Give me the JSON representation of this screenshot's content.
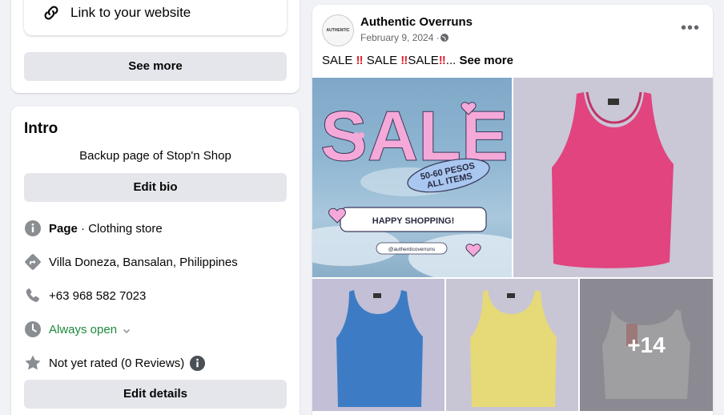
{
  "left": {
    "link_text": "Link to your website",
    "see_more": "See more"
  },
  "intro": {
    "title": "Intro",
    "bio": "Backup page of Stop'n Shop",
    "edit_bio": "Edit bio",
    "page_label": "Page",
    "page_category": " · Clothing store",
    "location": "Villa Doneza, Bansalan, Philippines",
    "phone": "+63 968 582 7023",
    "hours": "Always open",
    "rating": "Not yet rated (0 Reviews)",
    "edit_details": "Edit details"
  },
  "post": {
    "author": "Authentic Overruns",
    "avatar_text": "AUTHENTIC",
    "date": "February 9, 2024 · ",
    "text_sale1": "SALE ",
    "text_bang": "‼",
    "text_sale2": " SALE ",
    "text_sale3": "SALE",
    "text_ellipsis": "... ",
    "see_more": "See more",
    "sale_title": "SALE",
    "sale_badge_line1": "50-60 PESOS",
    "sale_badge_line2": "ALL ITEMS",
    "happy": "HAPPY SHOPPING!",
    "handle": "@authenticoverruns",
    "more_count": "+14"
  },
  "colors": {
    "accent_green": "#1c8a3b",
    "sale_pink": "#f5a9d9",
    "tank_pink": "#e1447f",
    "tank_blue": "#3d7cc4",
    "tank_yellow": "#e6d978"
  }
}
